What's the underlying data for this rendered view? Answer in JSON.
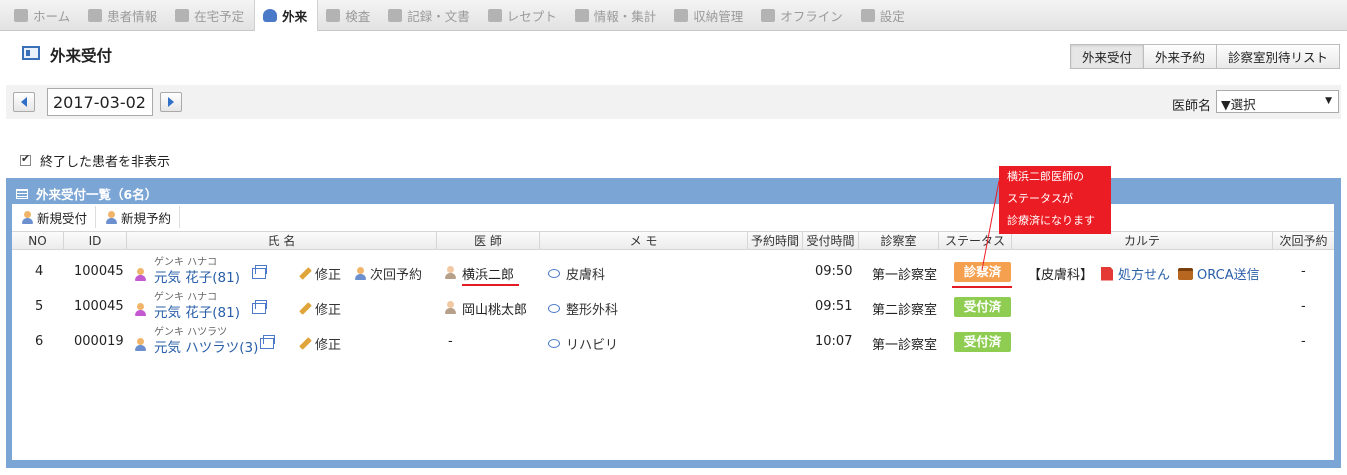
{
  "nav": {
    "tabs": [
      {
        "label": "ホーム",
        "icon": "home-icon"
      },
      {
        "label": "患者情報",
        "icon": "patient-info-icon"
      },
      {
        "label": "在宅予定",
        "icon": "clock-icon"
      },
      {
        "label": "外来",
        "icon": "outpatient-icon",
        "active": true
      },
      {
        "label": "検査",
        "icon": "chart-icon"
      },
      {
        "label": "記録・文書",
        "icon": "document-icon"
      },
      {
        "label": "レセプト",
        "icon": "receipt-icon"
      },
      {
        "label": "情報・集計",
        "icon": "stats-icon"
      },
      {
        "label": "収納管理",
        "icon": "cashier-icon"
      },
      {
        "label": "オフライン",
        "icon": "offline-icon"
      },
      {
        "label": "設定",
        "icon": "gear-icon"
      }
    ]
  },
  "header": {
    "title": "外来受付",
    "view_tabs": [
      "外来受付",
      "外来予約",
      "診察室別待リスト"
    ]
  },
  "date_bar": {
    "date": "2017-03-02",
    "doctor_label": "医師名",
    "doctor_select": "▼選択"
  },
  "filter": {
    "hide_finished_label": "終了した患者を非表示",
    "checked": true
  },
  "panel": {
    "title": "外来受付一覧（6名）",
    "toolbar": {
      "new_reception": "新規受付",
      "new_reservation": "新規予約"
    },
    "columns": [
      "NO",
      "ID",
      "氏 名",
      "医 師",
      "メ モ",
      "予約時間",
      "受付時間",
      "診察室",
      "ステータス",
      "カルテ",
      "次回予約"
    ],
    "rows": [
      {
        "no": "4",
        "id": "100045",
        "kana": "ゲンキ ハナコ",
        "name": "元気 花子(81)",
        "edit": "修正",
        "next_reservation_link": "次回予約",
        "doctor": "横浜二郎",
        "memo": "皮膚科",
        "reserve_time": "",
        "reception_time": "09:50",
        "room": "第一診察室",
        "status": "診察済",
        "karte_dept": "【皮膚科】",
        "karte_rx": "処方せん",
        "karte_orca": "ORCA送信",
        "next": "-"
      },
      {
        "no": "5",
        "id": "100045",
        "kana": "ゲンキ ハナコ",
        "name": "元気 花子(81)",
        "edit": "修正",
        "doctor": "岡山桃太郎",
        "memo": "整形外科",
        "reserve_time": "",
        "reception_time": "09:51",
        "room": "第二診察室",
        "status": "受付済",
        "next": "-"
      },
      {
        "no": "6",
        "id": "000019",
        "kana": "ゲンキ ハツラツ",
        "name": "元気 ハツラツ(3)",
        "edit": "修正",
        "doctor": "-",
        "memo": "リハビリ",
        "reserve_time": "",
        "reception_time": "10:07",
        "room": "第一診察室",
        "status": "受付済",
        "next": "-"
      }
    ]
  },
  "annotation": {
    "lines": [
      "横浜二郎医師の",
      "ステータスが",
      "診療済になります"
    ],
    "color": "#ec1c24"
  },
  "colors": {
    "panel": "#7ba5d4",
    "status_done": "#f4a04f",
    "status_received": "#8fcd52",
    "link": "#2a5fa8"
  }
}
